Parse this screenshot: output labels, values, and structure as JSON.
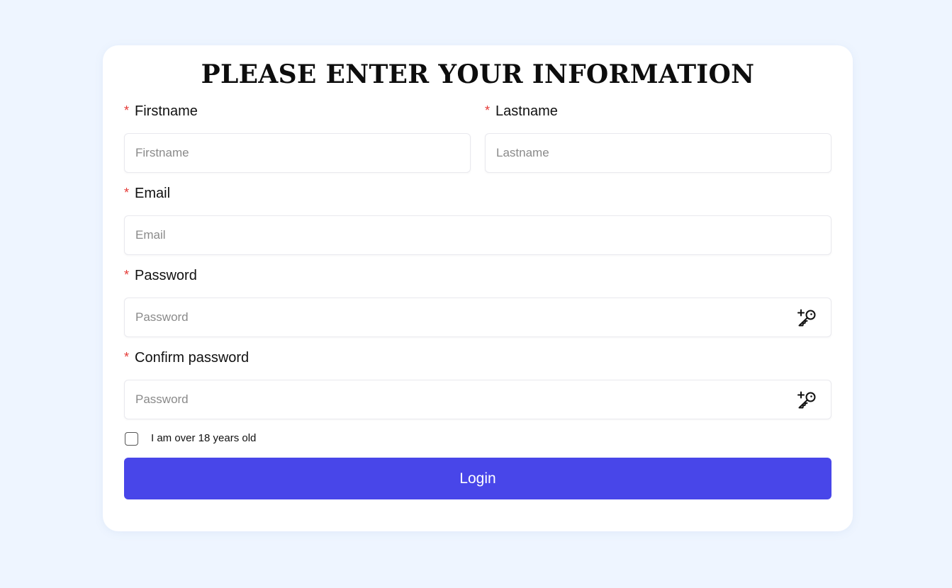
{
  "form": {
    "title": "PLEASE ENTER YOUR INFORMATION",
    "required_marker": "*",
    "firstname": {
      "label": "Firstname",
      "placeholder": "Firstname",
      "value": ""
    },
    "lastname": {
      "label": "Lastname",
      "placeholder": "Lastname",
      "value": ""
    },
    "email": {
      "label": "Email",
      "placeholder": "Email",
      "value": ""
    },
    "password": {
      "label": "Password",
      "placeholder": "Password",
      "value": "",
      "icon": "key-plus-icon"
    },
    "confirm_password": {
      "label": "Confirm password",
      "placeholder": "Password",
      "value": "",
      "icon": "key-plus-icon"
    },
    "age_checkbox": {
      "label": "I am over 18 years old",
      "checked": false
    },
    "submit_label": "Login"
  },
  "colors": {
    "background": "#eef5ff",
    "card": "#ffffff",
    "primary_button": "#4846e9",
    "required_marker": "#e53935"
  }
}
